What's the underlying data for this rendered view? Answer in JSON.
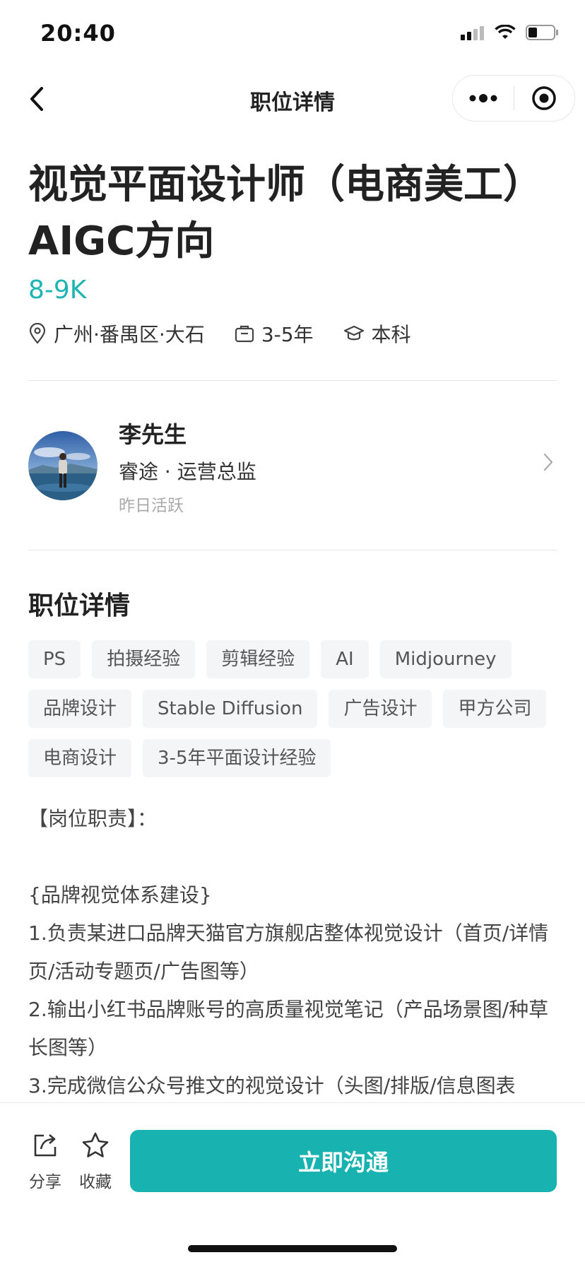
{
  "status_bar": {
    "time": "20:40"
  },
  "nav": {
    "title": "职位详情"
  },
  "job": {
    "title": "视觉平面设计师（电商美工）AIGC方向",
    "salary": "8-9K",
    "location": "广州·番禺区·大石",
    "experience": "3-5年",
    "education": "本科"
  },
  "recruiter": {
    "name": "李先生",
    "company_role": "睿途 · 运营总监",
    "activity": "昨日活跃"
  },
  "details": {
    "section_title": "职位详情",
    "tags": [
      "PS",
      "拍摄经验",
      "剪辑经验",
      "AI",
      "Midjourney",
      "品牌设计",
      "Stable Diffusion",
      "广告设计",
      "甲方公司",
      "电商设计",
      "3-5年平面设计经验"
    ],
    "description": [
      "【岗位职责】：",
      "",
      "{品牌视觉体系建设}",
      "1.负责某进口品牌天猫官方旗舰店整体视觉设计（首页/详情页/活动专题页/广告图等）",
      "2.输出小红书品牌账号的高质量视觉笔记（产品场景图/种草长图等）",
      "3.完成微信公众号推文的视觉设计（头图/排版/信息图表"
    ]
  },
  "bottom": {
    "share_label": "分享",
    "favorite_label": "收藏",
    "chat_label": "立即沟通"
  },
  "colors": {
    "accent": "#1eb4b4",
    "button": "#18b2b0"
  }
}
